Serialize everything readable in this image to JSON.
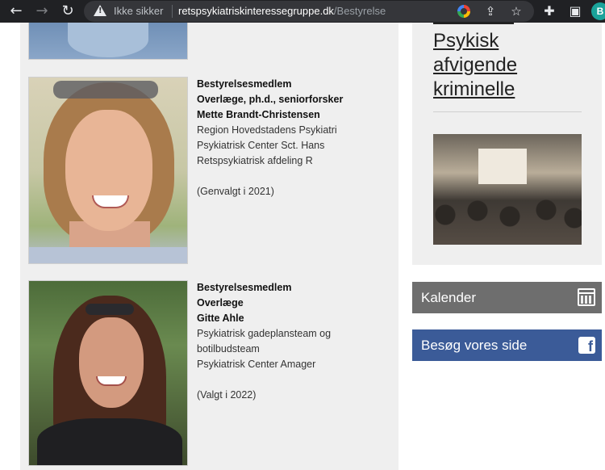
{
  "browser": {
    "security_label": "Ikke sikker",
    "url_host": "retspsykiatriskinteressegruppe.dk",
    "url_path": "/Bestyrelse",
    "profile_initial": "B"
  },
  "members": [
    {
      "role": "Bestyrelsesmedlem",
      "title": "Overlæge, ph.d., seniorforsker",
      "name": "Mette Brandt-Christensen",
      "lines": [
        "Region Hovedstadens Psykiatri",
        "Psykiatrisk Center Sct. Hans",
        "Retspsykiatrisk afdeling R"
      ],
      "status": "(Genvalgt i 2021)"
    },
    {
      "role": "Bestyrelsesmedlem",
      "title": "Overlæge",
      "name": "Gitte Ahle",
      "lines": [
        "Psykiatrisk gadeplansteam og",
        "botilbudsteam",
        "Psykiatrisk Center Amager"
      ],
      "status": "(Valgt i 2022)"
    }
  ],
  "sidebar": {
    "link_text": "Psykisk afvigende kriminelle",
    "calendar_label": "Kalender",
    "facebook_label": "Besøg vores side"
  }
}
